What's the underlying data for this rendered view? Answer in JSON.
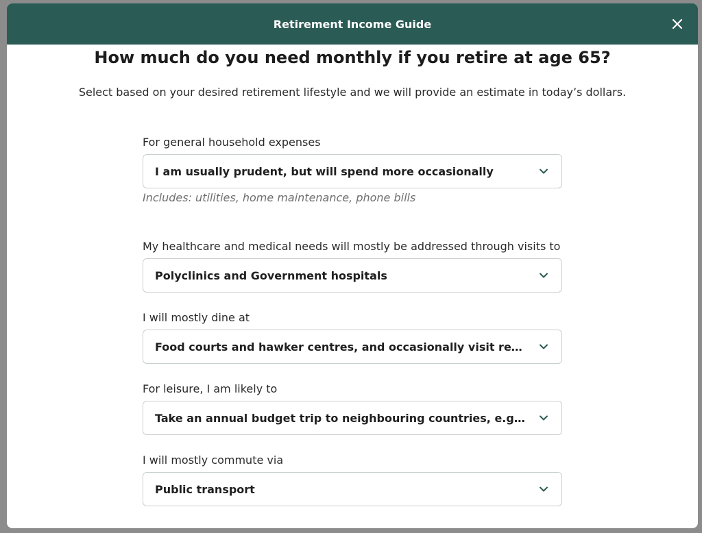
{
  "header": {
    "title": "Retirement Income Guide",
    "close_icon": "close-icon"
  },
  "main": {
    "heading": "How much do you need monthly if you retire at age 65?",
    "subheading": "Select based on your desired retirement lifestyle and we will provide an estimate in today’s dollars."
  },
  "fields": [
    {
      "label": "For general household expenses",
      "value": "I am usually prudent, but will spend more occasionally",
      "hint": "Includes: utilities, home maintenance, phone bills"
    },
    {
      "label": "My healthcare and medical needs will mostly be addressed through visits to",
      "value": "Polyclinics and Government hospitals"
    },
    {
      "label": "I will mostly dine at",
      "value": "Food courts and hawker centres, and occasionally visit resta..."
    },
    {
      "label": "For leisure, I am likely to",
      "value": "Take an annual budget trip to neighbouring countries, e.g. S..."
    },
    {
      "label": "I will mostly commute via",
      "value": "Public transport"
    }
  ],
  "colors": {
    "header_bg": "#2b5b55",
    "chevron": "#2b5b55",
    "overlay": "#8c8c8c"
  }
}
